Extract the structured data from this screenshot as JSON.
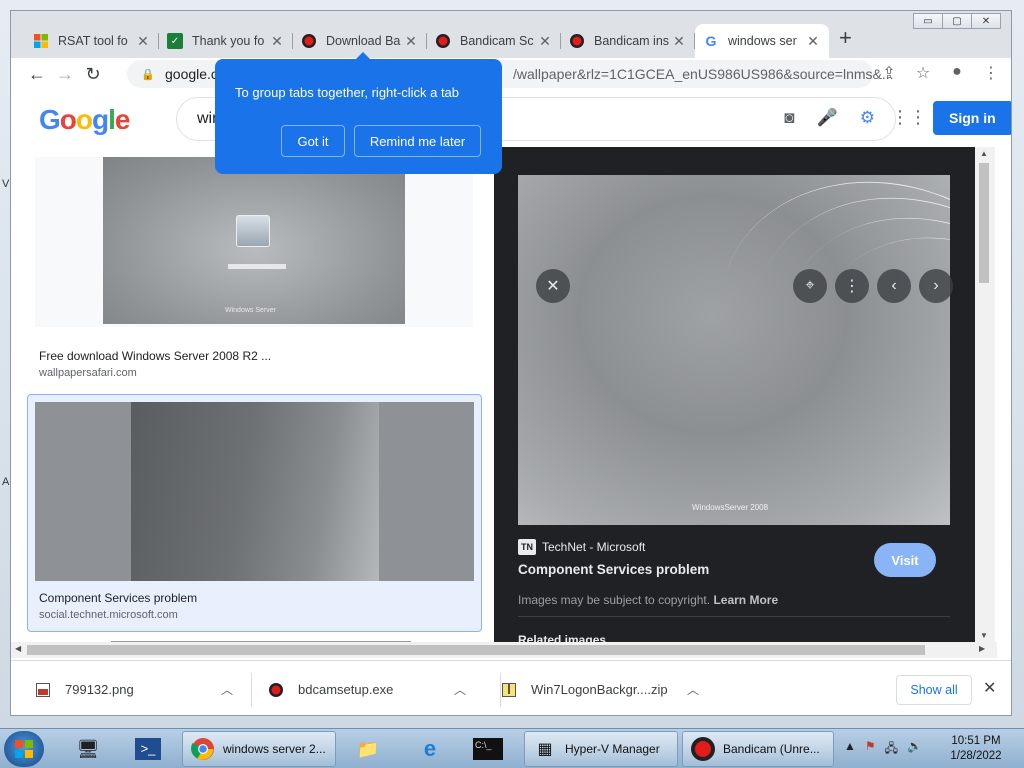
{
  "desktop": {
    "edge_labels": [
      "V",
      "A"
    ]
  },
  "window": {
    "controls": {
      "minimize": "▭",
      "maximize": "▢",
      "close": "✕"
    }
  },
  "tabs": [
    {
      "title": "RSAT tool fo",
      "favicon": "ms-logo-icon"
    },
    {
      "title": "Thank you fo",
      "favicon": "check-icon"
    },
    {
      "title": "Download Ba",
      "favicon": "bandicam-icon"
    },
    {
      "title": "Bandicam Sc",
      "favicon": "bandicam-icon"
    },
    {
      "title": "Bandicam ins",
      "favicon": "bandicam-icon"
    },
    {
      "title": "windows ser",
      "favicon": "google-g-icon"
    }
  ],
  "toolbar": {
    "url_host": "google.co",
    "url_rest": "/wallpaper&rlz=1C1GCEA_enUS986US986&source=lnms&..."
  },
  "google": {
    "logo_letters": [
      "G",
      "o",
      "o",
      "g",
      "l",
      "e"
    ],
    "search_value": "win",
    "sign_in": "Sign in"
  },
  "popup": {
    "message": "To group tabs together, right-click a tab",
    "got_it": "Got it",
    "remind_later": "Remind me later"
  },
  "results": [
    {
      "title": "Free download Windows Server 2008 R2 ...",
      "source": "wallpapersafari.com"
    },
    {
      "title": "Component Services problem",
      "source": "social.technet.microsoft.com"
    }
  ],
  "panel": {
    "source_logo": "TN",
    "source_name": "TechNet - Microsoft",
    "title": "Component Services problem",
    "visit": "Visit",
    "copyright": "Images may be subject to copyright.",
    "learn_more": "Learn More",
    "related": "Related images",
    "preview_brand": "WindowsServer 2008"
  },
  "downloads": {
    "items": [
      {
        "name": "799132.png"
      },
      {
        "name": "bdcamsetup.exe"
      },
      {
        "name": "Win7LogonBackgr....zip"
      }
    ],
    "show_all": "Show all"
  },
  "taskbar": {
    "tasks": [
      {
        "label": "windows server 2..."
      },
      {
        "label": "Hyper-V Manager"
      },
      {
        "label": "Bandicam (Unre..."
      }
    ],
    "clock_time": "10:51 PM",
    "clock_date": "1/28/2022"
  }
}
